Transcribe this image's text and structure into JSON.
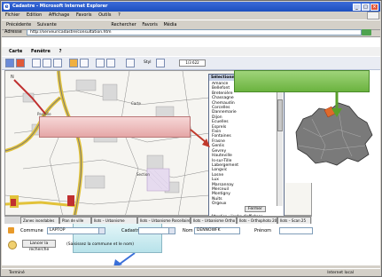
{
  "window": {
    "title": "Cadastre - Microsoft Internet Explorer",
    "controls": [
      "_",
      "□",
      "×"
    ]
  },
  "menubar": {
    "items": [
      "Fichier",
      "Edition",
      "Affichage",
      "Favoris",
      "Outils",
      "?"
    ]
  },
  "std_toolbar": {
    "items": [
      "Précédente",
      "Suivante",
      "Rechercher",
      "Favoris",
      "Média"
    ]
  },
  "address_bar": {
    "label": "Adresse",
    "value": "http://serveur/cadastre/consultation.htm"
  },
  "app_menu": {
    "items": [
      "Carte",
      "Fenêtre",
      "?"
    ]
  },
  "app_toolbar": {
    "scale_label": "Styl",
    "scale_value": "1/3 622"
  },
  "map": {
    "labels": [
      "Carte",
      "Section",
      "Parcelle",
      "N"
    ]
  },
  "panel": {
    "title": "Sélectionnez une position",
    "items": [
      "Amance",
      "Bellefont",
      "Bretenière",
      "Chassagne",
      "Chemaudin",
      "Corcelles",
      "Dannemarie",
      "Dijon",
      "Ecuelles",
      "Esprels",
      "Fixin",
      "Fontaines",
      "Frasne",
      "Genlis",
      "Gevrey",
      "Hauteville",
      "Is-sur-Tille",
      "Labergement",
      "Longvic",
      "Losne",
      "Lux",
      "Marsannay",
      "Merceuil",
      "Montigny",
      "Nuits",
      "Orgeux"
    ],
    "button": "Fermer",
    "footer": "Attention : l'ordre d'affichage"
  },
  "tabs": {
    "items": [
      "Zones inondables",
      "Plan de ville",
      "Ilots – Urbanisme",
      "Ilots – Urbanisme Parcellaire",
      "Ilots – Urbanisme Ortho",
      "Ilots – Orthophoto 2004",
      "Ilots – Scan 25"
    ]
  },
  "form": {
    "commune_label": "Commune",
    "commune_value": "LAPTOP",
    "cadastre_label": "Cadastre",
    "cadastre_value": "",
    "nom_label": "Nom",
    "nom_value": "DENNOWFK",
    "prenom_label": "Prénom",
    "prenom_value": "",
    "search_button": "Lancer la recherche",
    "hint": "(Saisissez la commune et le nom)"
  },
  "statusbar": {
    "left": "Terminé",
    "right": "Internet local"
  },
  "colors": {
    "callout_green": "#6bb33f",
    "callout_red": "#e5a7a7",
    "callout_cyan": "#b8e2ea",
    "arrow_green": "#5aa02a",
    "arrow_red": "#c0392b",
    "arrow_blue": "#3a6fd8"
  }
}
